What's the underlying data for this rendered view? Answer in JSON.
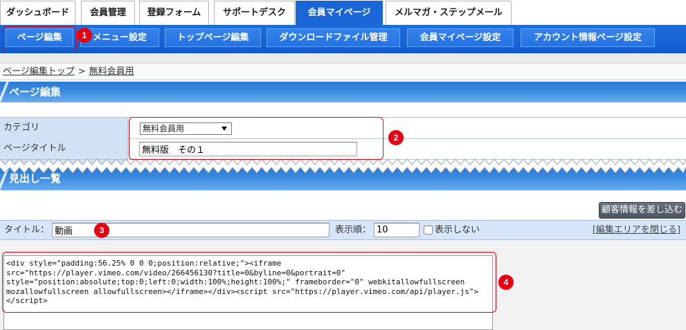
{
  "colors": {
    "nav_blue": "#1a66d6",
    "annotation_red": "#e60012"
  },
  "icons": {
    "select_arrow": "chevron-down-icon",
    "hide_toggle": "checkbox-icon"
  },
  "top_tabs": [
    {
      "label": "ダッシュボード",
      "active": false
    },
    {
      "label": "会員管理",
      "active": false
    },
    {
      "label": "登録フォーム",
      "active": false
    },
    {
      "label": "サポートデスク",
      "active": false
    },
    {
      "label": "会員マイページ",
      "active": true
    },
    {
      "label": "メルマガ・ステップメール",
      "active": false
    }
  ],
  "sub_nav": [
    {
      "label": "ページ編集",
      "active": true
    },
    {
      "label": "メニュー設定",
      "active": false
    },
    {
      "label": "トップページ編集",
      "active": false
    },
    {
      "label": "ダウンロードファイル管理",
      "active": false
    },
    {
      "label": "会員マイページ設定",
      "active": false
    },
    {
      "label": "アカウント情報ページ設定",
      "active": false
    }
  ],
  "breadcrumb": {
    "parent": "ページ編集トップ",
    "separator": ">",
    "current": "無料会員用"
  },
  "page_heading": "ページ編集",
  "page_form": {
    "category_label": "カテゴリ",
    "category_value": "無料会員用",
    "page_title_label": "ページタイトル",
    "page_title_value": "無料版　その１"
  },
  "section_heading": "見出し一覧",
  "insert_customer_info_button": "顧客情報を差し込む",
  "heading_editor": {
    "title_label": "タイトル：",
    "title_value": "動画",
    "order_label": "表示順：",
    "order_value": "10",
    "hide_label": "表示しない",
    "hide_checked": false,
    "close_link_open": "[",
    "close_link_label": "編集エリアを閉じる",
    "close_link_close": "]",
    "body": "<div style=\"padding:56.25% 0 0 0;position:relative;\"><iframe\nsrc=\"https://player.vimeo.com/video/266456130?title=0&byline=0&portrait=0\"\nstyle=\"position:absolute;top:0;left:0;width:100%;height:100%;\" frameborder=\"0\" webkitallowfullscreen\nmozallowfullscreen allowfullscreen></iframe></div><script src=\"https://player.vimeo.com/api/player.js\">\n</script>"
  },
  "annotations": [
    "1",
    "2",
    "3",
    "4"
  ]
}
